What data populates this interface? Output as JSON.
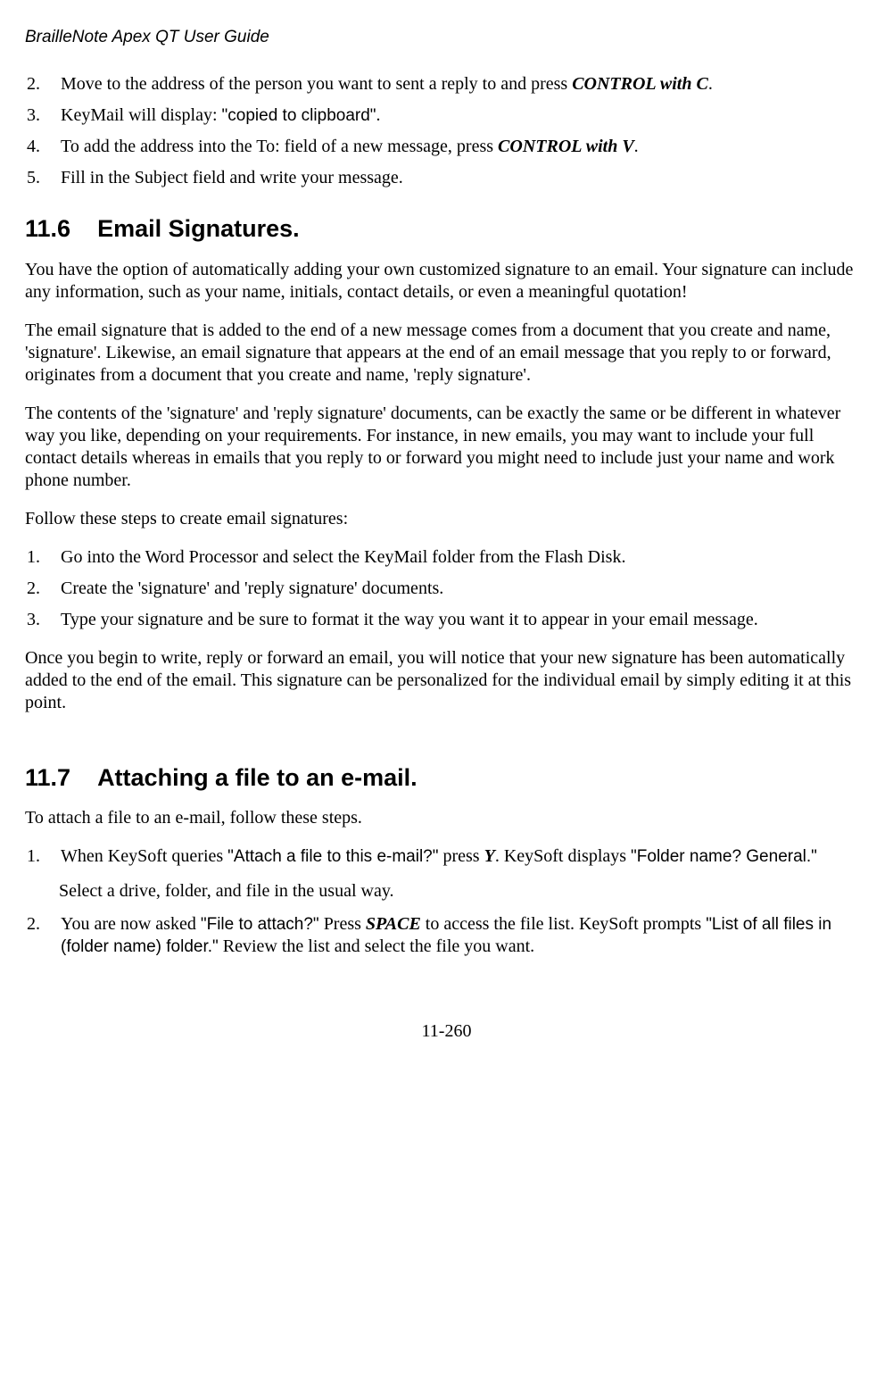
{
  "header": {
    "title": "BrailleNote Apex QT User Guide"
  },
  "topList": {
    "items": [
      {
        "num": "2.",
        "pre": "Move to the address of the person you want to sent a reply to and press ",
        "cmd": "CONTROL with C",
        "post": "."
      },
      {
        "num": "3.",
        "pre": "KeyMail will display: ",
        "ui": "\"copied to clipboard\"",
        "post": "."
      },
      {
        "num": "4.",
        "pre": "To add the address into the To: field of a new message, press ",
        "cmd": "CONTROL with V",
        "post": "."
      },
      {
        "num": "5.",
        "pre": "Fill in the Subject field and write your message."
      }
    ]
  },
  "section116": {
    "num": "11.6",
    "title": "Email Signatures.",
    "p1": "You have the option of automatically adding your own customized signature to an email. Your signature can include any information, such as your name, initials, contact details, or even a meaningful quotation!",
    "p2": "The email signature that is added to the end of a new message comes from a document that you create and name, 'signature'. Likewise, an email signature that appears at the end of an email message that you reply to or forward, originates from a document that you create and name, 'reply signature'.",
    "p3": "The contents of the 'signature' and 'reply signature' documents, can be exactly the same or be different in whatever way you like, depending on your requirements. For instance, in new emails, you may want to include your full contact details whereas in emails that you reply to or forward you might need to include just your name and work phone number.",
    "p4": "Follow these steps to create email signatures:",
    "steps": [
      {
        "num": "1.",
        "text": "Go into the Word Processor and select the KeyMail folder from the Flash Disk."
      },
      {
        "num": "2.",
        "text": "Create the 'signature' and 'reply signature' documents."
      },
      {
        "num": "3.",
        "text": "Type your signature and be sure to format it the way you want it to appear in your email message."
      }
    ],
    "p5": "Once you begin to write, reply or forward an email, you will notice that your new signature has been automatically added to the end of the email. This signature can be personalized for the individual email by simply editing it at this point."
  },
  "section117": {
    "num": "11.7",
    "title": "Attaching a file to an e-mail.",
    "p1": "To attach a file to an e-mail, follow these steps.",
    "steps": [
      {
        "num": "1.",
        "pre": "When KeySoft queries ",
        "ui1": "\"Attach a file to this e-mail?\"",
        "mid1": " press ",
        "key": "Y",
        "mid2": ". KeySoft displays ",
        "ui2": "\"Folder name? General.\"",
        "sub": "Select a drive, folder, and file in the usual way."
      },
      {
        "num": "2.",
        "pre": "You are now asked ",
        "ui1": "\"File to attach?\"",
        "mid1": " Press ",
        "key": "SPACE",
        "mid2": " to access the file list. KeySoft prompts ",
        "ui2": "\"List of all files in (folder name) folder.\"",
        "post": " Review the list and select the file you want."
      }
    ]
  },
  "footer": {
    "pageNum": "11-260"
  }
}
